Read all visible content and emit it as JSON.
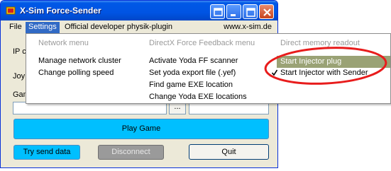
{
  "window": {
    "title": "X-Sim Force-Sender"
  },
  "menubar": {
    "items": [
      "File",
      "Settings",
      "Official developer physik-plugin"
    ],
    "url": "www.x-sim.de"
  },
  "form": {
    "ip_label_partial": "IP c",
    "joy_label_partial": "Joy",
    "game_label_partial": "Gam",
    "browse_label": "..."
  },
  "buttons": {
    "play_game": "Play Game",
    "try_send": "Try send data",
    "disconnect": "Disconnect",
    "quit": "Quit"
  },
  "dropdown": {
    "network": {
      "header": "Network menu",
      "items": [
        "Manage network cluster",
        "Change polling speed"
      ]
    },
    "directx": {
      "header": "DirectX Force Feedback menu",
      "items": [
        "Activate Yoda FF scanner",
        "Set yoda export file (.yef)",
        "Find game EXE location",
        "Change Yoda EXE locations"
      ]
    },
    "memory": {
      "header": "Direct memory readout",
      "items": [
        "Start Injector plug",
        "Start Injector with Sender"
      ]
    }
  },
  "colors": {
    "titlebar": "#0054e3",
    "menu_highlight": "#316ac5",
    "item_highlight": "#9aa275",
    "button_cyan": "#00bfff",
    "annotation_ring": "#e81c1c"
  }
}
